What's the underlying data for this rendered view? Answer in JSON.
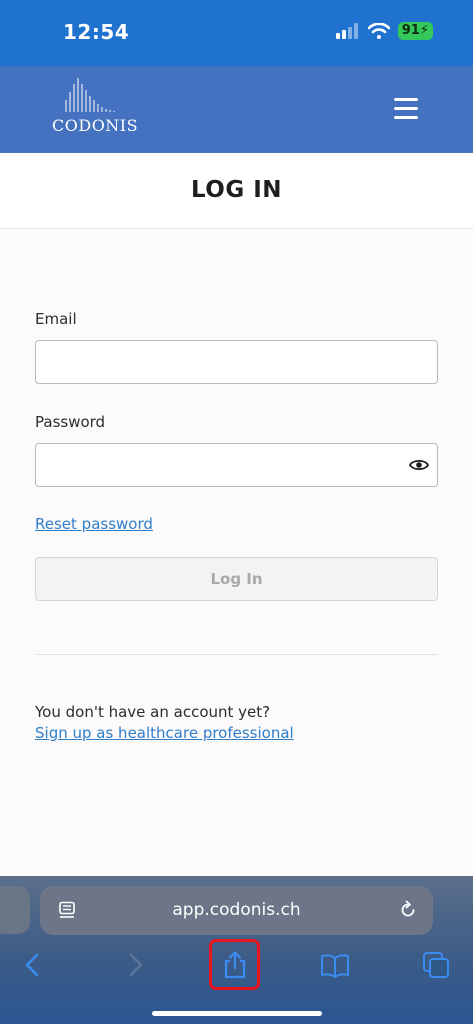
{
  "status_bar": {
    "time": "12:54",
    "battery": "91"
  },
  "header": {
    "logo_text": "CODONIS"
  },
  "page": {
    "title": "LOG IN"
  },
  "form": {
    "email_label": "Email",
    "email_value": "",
    "password_label": "Password",
    "password_value": "",
    "reset_link": "Reset password",
    "login_button": "Log In"
  },
  "signup": {
    "prompt": "You don't have an account yet?",
    "link": "Sign up as healthcare professional"
  },
  "browser": {
    "url": "app.codonis.ch"
  },
  "colors": {
    "status_bar": "#1f72cf",
    "header": "#4572c0",
    "link": "#2f7ec9",
    "highlight": "#e8141e"
  }
}
